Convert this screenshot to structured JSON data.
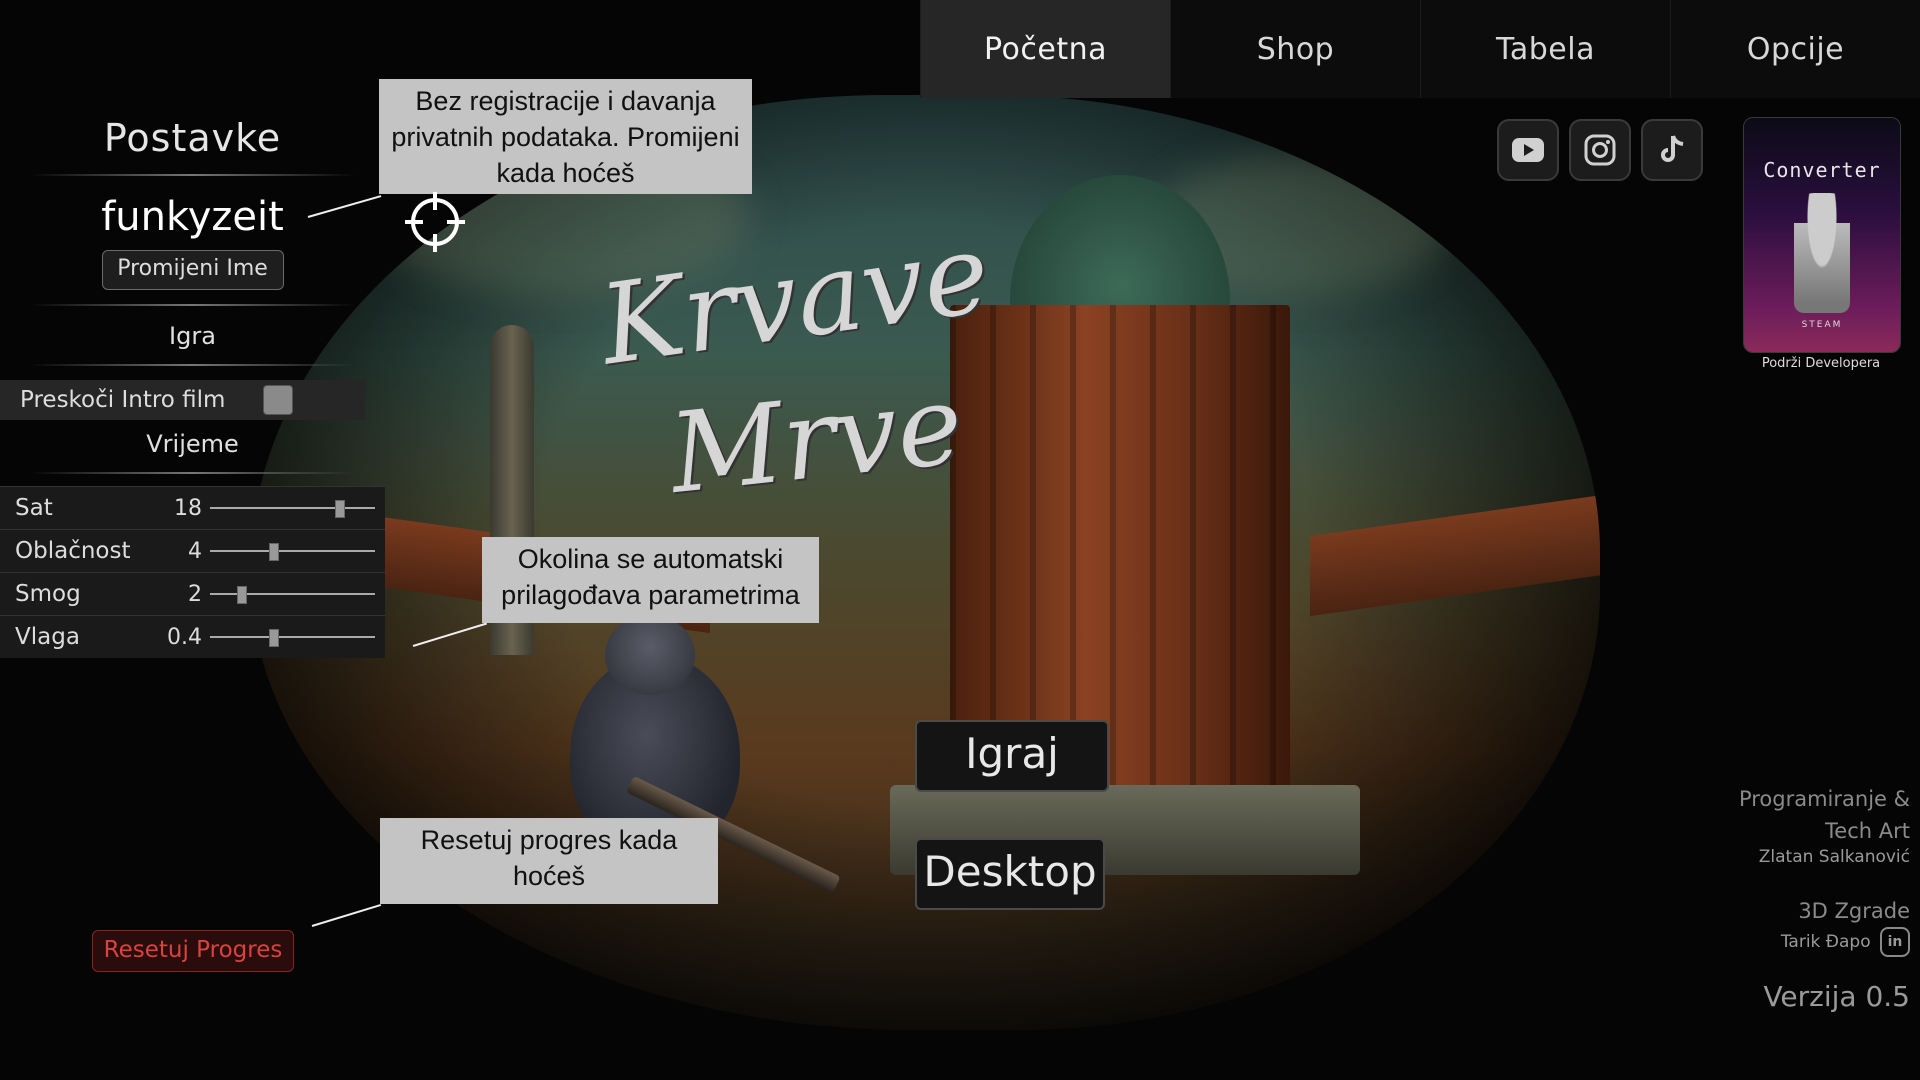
{
  "nav": {
    "tabs": [
      {
        "label": "Početna",
        "active": true
      },
      {
        "label": "Shop",
        "active": false
      },
      {
        "label": "Tabela",
        "active": false
      },
      {
        "label": "Opcije",
        "active": false
      }
    ]
  },
  "settings": {
    "title": "Postavke",
    "username": "funkyzeit",
    "rename_button": "Promijeni Ime",
    "game_section": "Igra",
    "skip_intro_label": "Preskoči Intro film",
    "skip_intro_checked": false,
    "time_section": "Vrijeme",
    "sliders": [
      {
        "label": "Sat",
        "value": "18",
        "fraction": 0.78
      },
      {
        "label": "Oblačnost",
        "value": "4",
        "fraction": 0.38
      },
      {
        "label": "Smog",
        "value": "2",
        "fraction": 0.19
      },
      {
        "label": "Vlaga",
        "value": "0.4",
        "fraction": 0.38
      }
    ],
    "reset_button": "Resetuj Progres"
  },
  "title_art": {
    "line1": "Krvave",
    "line2": "Mrve"
  },
  "main_buttons": {
    "play": "Igraj",
    "desktop": "Desktop"
  },
  "social": [
    "youtube-icon",
    "instagram-icon",
    "tiktok-icon"
  ],
  "support": {
    "logo_text": "Converter",
    "steam_text": "STEAM",
    "caption": "Podrži Developera"
  },
  "credits": {
    "role1": "Programiranje &",
    "role1b": "Tech Art",
    "name1": "Zlatan Salkanović",
    "role2": "3D Zgrade",
    "name2": "Tarik Đapo",
    "linkedin": "in",
    "version": "Verzija 0.5"
  },
  "annotations": {
    "registration": "Bez registracije i davanja privatnih podataka. Promijeni kada hoćeš",
    "environment": "Okolina se automatski prilagođava parametrima",
    "reset": "Resetuj progres kada hoćeš"
  },
  "colors": {
    "accent_reset": "#d8433f",
    "active_tab": "#262626",
    "annotation_bg": "#c4c4c4"
  }
}
